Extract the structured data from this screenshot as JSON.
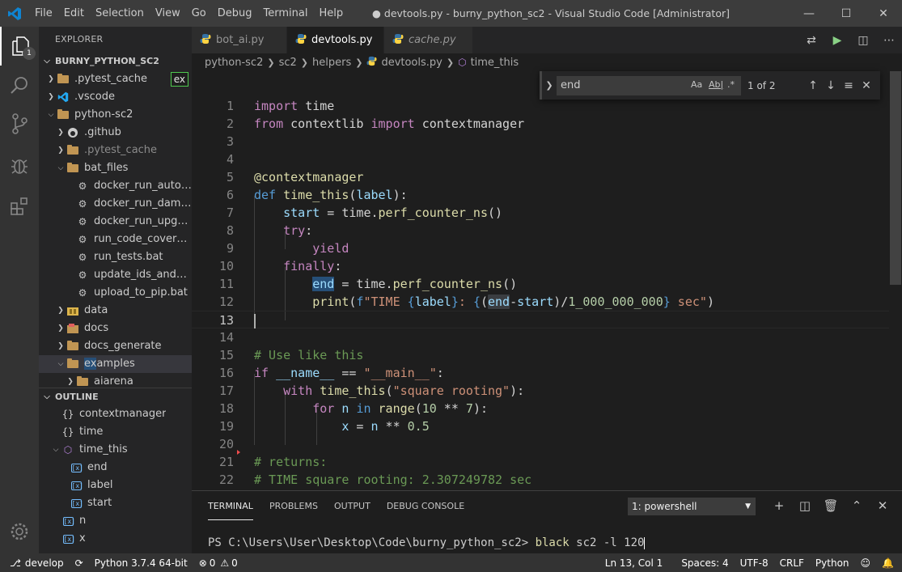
{
  "titlebar": {
    "menu": [
      "File",
      "Edit",
      "Selection",
      "View",
      "Go",
      "Debug",
      "Terminal",
      "Help"
    ],
    "title": "● devtools.py - burny_python_sc2 - Visual Studio Code [Administrator]"
  },
  "activitybar": {
    "explorer_badge": "1",
    "items": [
      "files-icon",
      "search-icon",
      "source-control-icon",
      "debug-icon",
      "extensions-icon",
      "settings-gear-icon"
    ]
  },
  "explorer": {
    "title": "EXPLORER",
    "root": "BURNY_PYTHON_SC2",
    "filter_badge": "ex",
    "items": [
      {
        "label": ".pytest_cache",
        "type": "folder",
        "state": "collapsed",
        "indent": 1
      },
      {
        "label": ".vscode",
        "type": "vscode-folder",
        "state": "collapsed",
        "indent": 1
      },
      {
        "label": "python-sc2",
        "type": "folder",
        "state": "expanded",
        "indent": 1
      },
      {
        "label": ".github",
        "type": "github-folder",
        "state": "collapsed",
        "indent": 2
      },
      {
        "label": ".pytest_cache",
        "type": "folder",
        "state": "collapsed",
        "indent": 2,
        "dim": true
      },
      {
        "label": "bat_files",
        "type": "folder",
        "state": "expanded",
        "indent": 2
      },
      {
        "label": "docker_run_autotest.bat",
        "type": "bat",
        "indent": 3
      },
      {
        "label": "docker_run_damage_test.bat",
        "type": "bat",
        "indent": 3
      },
      {
        "label": "docker_run_upgrade_test.bat",
        "type": "bat",
        "indent": 3
      },
      {
        "label": "run_code_coverage.bat",
        "type": "bat",
        "indent": 3
      },
      {
        "label": "run_tests.bat",
        "type": "bat",
        "indent": 3
      },
      {
        "label": "update_ids_and_pip.bat",
        "type": "bat",
        "indent": 3
      },
      {
        "label": "upload_to_pip.bat",
        "type": "bat",
        "indent": 3
      },
      {
        "label": "data",
        "type": "folder-yellow",
        "state": "collapsed",
        "indent": 2
      },
      {
        "label": "docs",
        "type": "docs-folder",
        "state": "collapsed",
        "indent": 2
      },
      {
        "label": "docs_generate",
        "type": "folder",
        "state": "collapsed",
        "indent": 2
      },
      {
        "label_hl": "ex",
        "label_rest": "amples",
        "type": "folder",
        "state": "expanded",
        "indent": 2,
        "selected": true
      },
      {
        "label": "aiarena",
        "type": "folder",
        "state": "collapsed",
        "indent": 3
      }
    ]
  },
  "outline": {
    "title": "OUTLINE",
    "items": [
      {
        "label": "contextmanager",
        "kind": "module",
        "indent": 1
      },
      {
        "label": "time",
        "kind": "module",
        "indent": 1
      },
      {
        "label": "time_this",
        "kind": "function",
        "indent": 1,
        "state": "expanded"
      },
      {
        "label": "end",
        "kind": "variable",
        "indent": 2
      },
      {
        "label": "label",
        "kind": "variable",
        "indent": 2
      },
      {
        "label": "start",
        "kind": "variable",
        "indent": 2
      },
      {
        "label": "n",
        "kind": "variable",
        "indent": 1
      },
      {
        "label": "x",
        "kind": "variable",
        "indent": 1
      }
    ]
  },
  "tabs": [
    {
      "label": "bot_ai.py",
      "active": false,
      "italic": false,
      "dirty": false
    },
    {
      "label": "devtools.py",
      "active": true,
      "italic": false,
      "dirty": true
    },
    {
      "label": "cache.py",
      "active": false,
      "italic": true,
      "dirty": false
    }
  ],
  "breadcrumbs": [
    "python-sc2",
    "sc2",
    "helpers",
    "devtools.py",
    "time_this"
  ],
  "find": {
    "query": "end",
    "match_case": "Aa",
    "whole_word": "Ab|",
    "regex": ".*",
    "result": "1 of 2"
  },
  "code": {
    "line_numbers": [
      "1",
      "2",
      "3",
      "4",
      "5",
      "6",
      "7",
      "8",
      "9",
      "10",
      "11",
      "12",
      "13",
      "14",
      "15",
      "16",
      "17",
      "18",
      "19",
      "20",
      "21",
      "22"
    ],
    "current_line": 13
  },
  "panel": {
    "tabs": [
      "TERMINAL",
      "PROBLEMS",
      "OUTPUT",
      "DEBUG CONSOLE"
    ],
    "active_tab": "TERMINAL",
    "terminal_select": "1: powershell",
    "prompt": "PS C:\\Users\\User\\Desktop\\Code\\burny_python_sc2> ",
    "command": "black",
    "args": " sc2 -l 120"
  },
  "statusbar": {
    "branch": "develop",
    "python": "Python 3.7.4 64-bit",
    "errors": "0",
    "warnings": "0",
    "position": "Ln 13, Col 1",
    "spaces": "Spaces: 4",
    "encoding": "UTF-8",
    "eol": "CRLF",
    "language": "Python"
  },
  "colors": {
    "accent_vscode_blue": "#007acc",
    "python_yellow": "#ffd343",
    "python_blue": "#3572a5",
    "folder": "#c09553",
    "find_highlight": "#264f78"
  }
}
